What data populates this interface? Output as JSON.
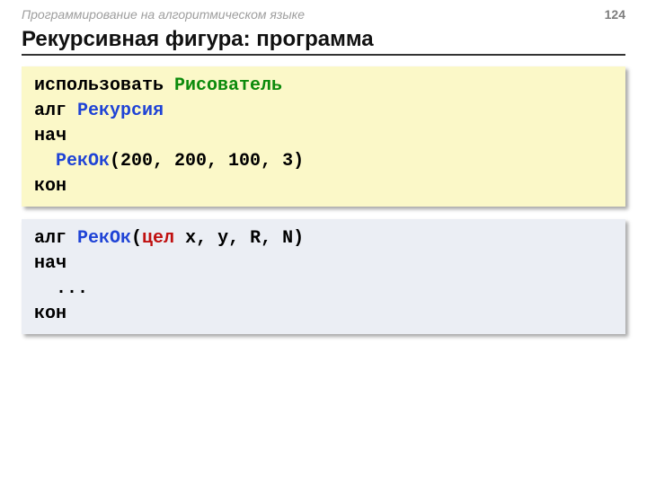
{
  "header": {
    "course": "Программирование на алгоритмическом языке",
    "page": "124"
  },
  "title": "Рекурсивная фигура: программа",
  "code1": {
    "l1a": "использовать ",
    "l1b": "Рисователь",
    "l2a": "алг ",
    "l2b": "Рекурсия",
    "l3": "нач",
    "l4a": "  ",
    "l4b": "РекОк",
    "l4c": "(200, 200, 100, 3)",
    "l5": "кон"
  },
  "code2": {
    "l1a": "алг ",
    "l1b": "РекОк",
    "l1c": "(",
    "l1d": "цел",
    "l1e": " x, y, R, N)",
    "l2": "нач",
    "l3": "  ...",
    "l4": "кон"
  }
}
